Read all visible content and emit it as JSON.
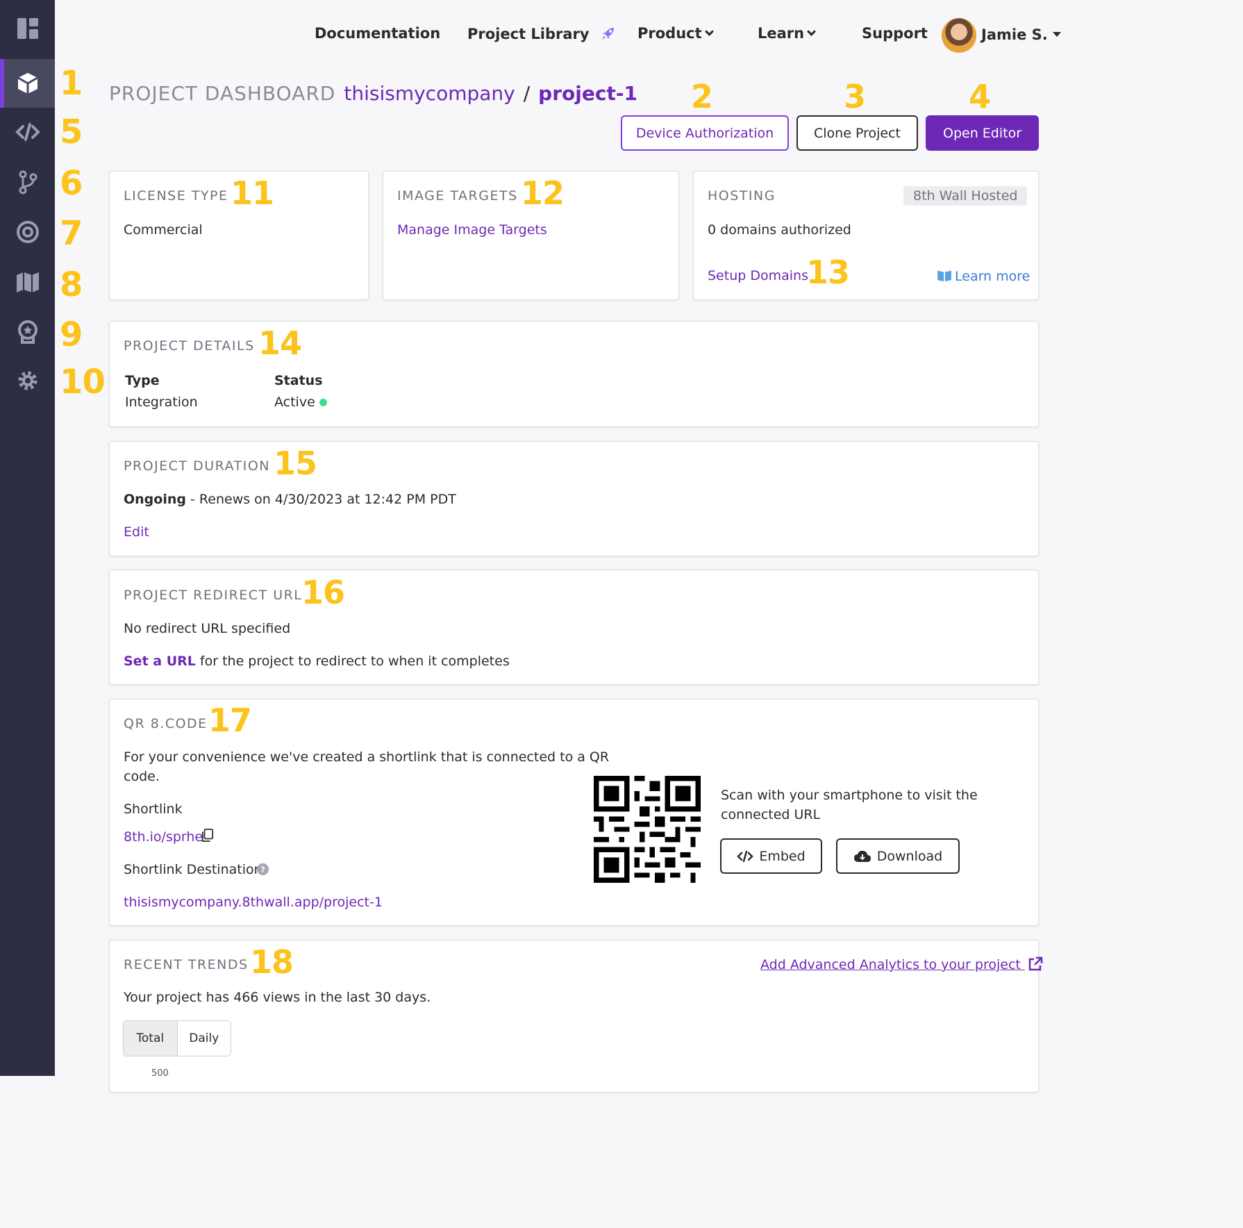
{
  "nav": {
    "documentation": "Documentation",
    "project_library": "Project Library",
    "product": "Product",
    "learn": "Learn",
    "support": "Support",
    "user_name": "Jamie S."
  },
  "breadcrumb": {
    "section": "PROJECT DASHBOARD",
    "workspace": "thisismycompany",
    "separator": "/",
    "project": "project-1"
  },
  "actions": {
    "device_authorization": "Device Authorization",
    "clone_project": "Clone Project",
    "open_editor": "Open Editor"
  },
  "annotations": {
    "a1": "1",
    "a2": "2",
    "a3": "3",
    "a4": "4",
    "a5": "5",
    "a6": "6",
    "a7": "7",
    "a8": "8",
    "a9": "9",
    "a10": "10",
    "a11": "11",
    "a12": "12",
    "a13": "13",
    "a14": "14",
    "a15": "15",
    "a16": "16",
    "a17": "17",
    "a18": "18"
  },
  "license": {
    "title": "LICENSE TYPE",
    "value": "Commercial"
  },
  "image_targets": {
    "title": "IMAGE TARGETS",
    "link": "Manage Image Targets"
  },
  "hosting": {
    "title": "HOSTING",
    "badge": "8th Wall Hosted",
    "domains": "0 domains authorized",
    "setup_link": "Setup Domains",
    "learn_more": "Learn more"
  },
  "details": {
    "title": "PROJECT DETAILS",
    "type_label": "Type",
    "type_value": "Integration",
    "status_label": "Status",
    "status_value": "Active"
  },
  "duration": {
    "title": "PROJECT DURATION",
    "status": "Ongoing",
    "renews": " - Renews on 4/30/2023 at 12:42 PM PDT",
    "edit": "Edit"
  },
  "redirect": {
    "title": "PROJECT REDIRECT URL",
    "none": "No redirect URL specified",
    "set_link": "Set a URL",
    "set_rest": " for the project to redirect to when it completes"
  },
  "qr": {
    "title": "QR 8.CODE",
    "desc_line1": "For your convenience we've created a shortlink that is connected to a QR",
    "desc_line2": "code.",
    "shortlink_label": "Shortlink",
    "shortlink": "8th.io/sprhe",
    "destination_label": "Shortlink Destination",
    "destination": "thisismycompany.8thwall.app/project-1",
    "scan_line1": "Scan with your smartphone to visit the",
    "scan_line2": "connected URL",
    "embed": "Embed",
    "download": "Download"
  },
  "trends": {
    "title": "RECENT TRENDS",
    "analytics_link": "Add Advanced Analytics to your project",
    "summary": "Your project has 466 views in the last 30 days.",
    "tab_total": "Total",
    "tab_daily": "Daily",
    "axis_top": "500"
  },
  "colors": {
    "accent": "#6d28b5",
    "sidebar": "#2d2e43",
    "annotation": "#fcc31c",
    "status_active": "#3ddc97"
  }
}
